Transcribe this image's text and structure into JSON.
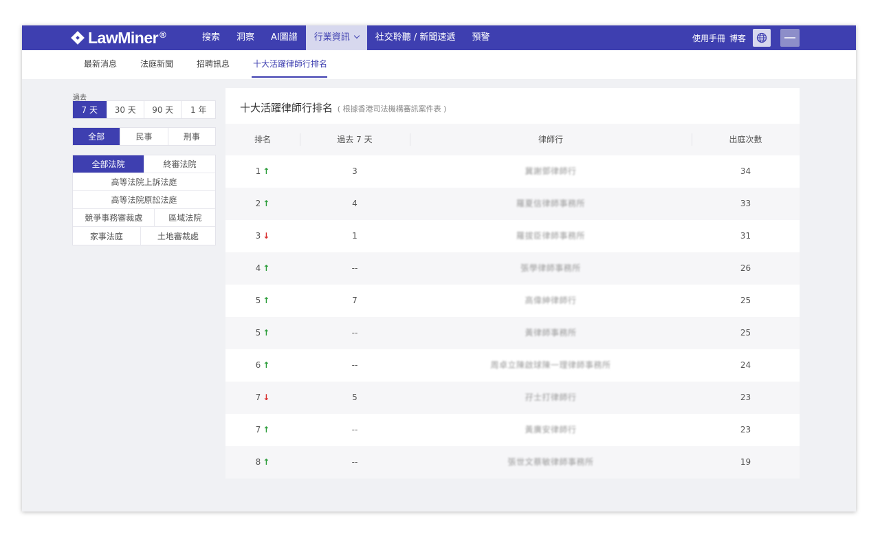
{
  "topnav": {
    "logo_text": "LawMiner",
    "logo_mark": "®",
    "items": [
      {
        "label": "搜索"
      },
      {
        "label": "洞察"
      },
      {
        "label": "AI圖譜"
      },
      {
        "label": "行業資訊"
      },
      {
        "label": "社交聆聽 / 新聞速遞"
      },
      {
        "label": "預警"
      }
    ],
    "manual": "使用手冊",
    "blog": "博客",
    "globe_icon": "globe-icon"
  },
  "subnav": {
    "items": [
      {
        "label": "最新消息"
      },
      {
        "label": "法庭新聞"
      },
      {
        "label": "招聘訊息"
      },
      {
        "label": "十大活躍律師行排名"
      }
    ]
  },
  "filters": {
    "past_label": "過去",
    "periods": [
      "7 天",
      "30 天",
      "90 天",
      "1 年"
    ],
    "case_types": [
      "全部",
      "民事",
      "刑事"
    ],
    "courts": {
      "all": "全部法院",
      "final": "終審法院",
      "high_appeal": "高等法院上訴法庭",
      "high_first": "高等法院原訟法庭",
      "competition": "競爭事務審裁處",
      "district": "區域法院",
      "family": "家事法庭",
      "lands": "土地審裁處"
    }
  },
  "ranking": {
    "title": "十大活躍律師行排名",
    "subtitle": "( 根據香港司法機構審訊案件表 )",
    "headers": {
      "rank": "排名",
      "past7": "過去 7 天",
      "firm": "律師行",
      "count": "出庭次數"
    },
    "rows": [
      {
        "rank": "1",
        "trend": "↑",
        "past": "3",
        "firm": "冀謝鄧律師行",
        "count": "34"
      },
      {
        "rank": "2",
        "trend": "↑",
        "past": "4",
        "firm": "羅夏信律師事務所",
        "count": "33"
      },
      {
        "rank": "3",
        "trend": "↓",
        "past": "1",
        "firm": "羅拔臣律師事務所",
        "count": "31"
      },
      {
        "rank": "4",
        "trend": "↑",
        "past": "--",
        "firm": "張學律師事務所",
        "count": "26"
      },
      {
        "rank": "5",
        "trend": "↑",
        "past": "7",
        "firm": "高偉紳律師行",
        "count": "25"
      },
      {
        "rank": "5",
        "trend": "↑",
        "past": "--",
        "firm": "黃律師事務所",
        "count": "25"
      },
      {
        "rank": "6",
        "trend": "↑",
        "past": "--",
        "firm": "周卓立陳啟球陳一理律師事務所",
        "count": "24"
      },
      {
        "rank": "7",
        "trend": "↓",
        "past": "5",
        "firm": "孖士打律師行",
        "count": "23"
      },
      {
        "rank": "7",
        "trend": "↑",
        "past": "--",
        "firm": "黃廣安律師行",
        "count": "23"
      },
      {
        "rank": "8",
        "trend": "↑",
        "past": "--",
        "firm": "張世文蔡敏律師事務所",
        "count": "19"
      }
    ]
  }
}
